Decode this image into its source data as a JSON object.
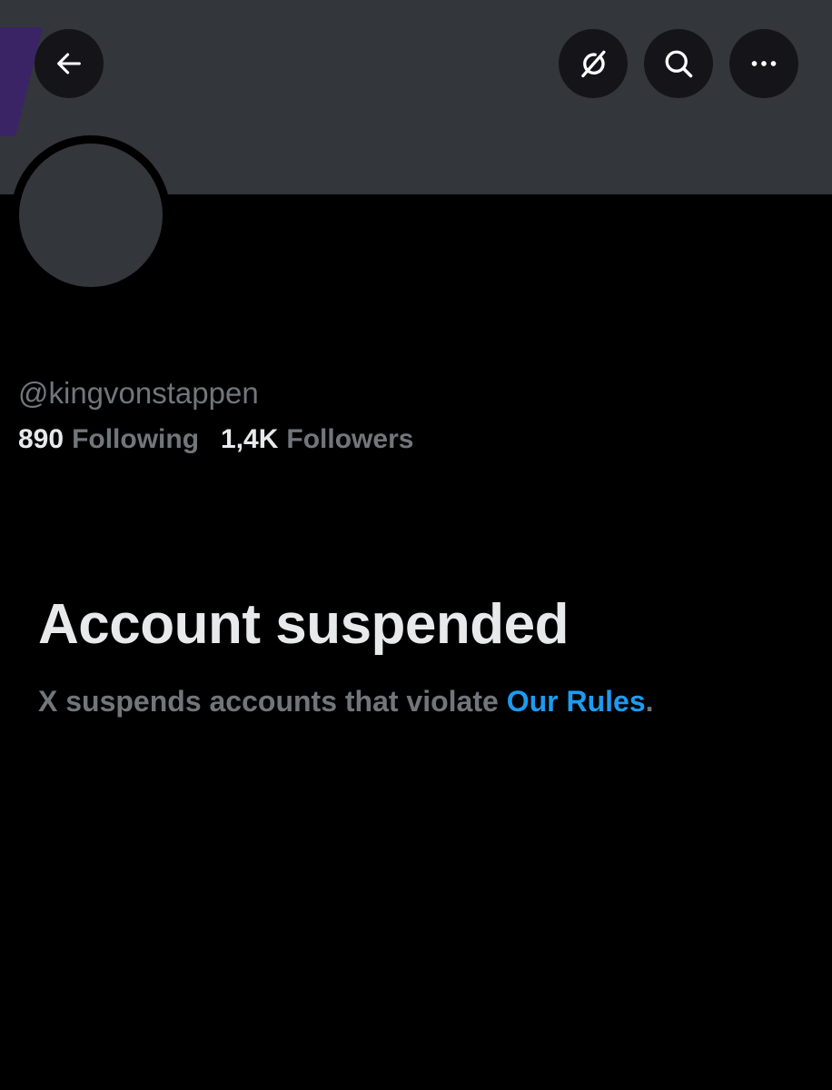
{
  "header": {
    "back_icon": "arrow-left-icon",
    "grok_icon": "grok-icon",
    "search_icon": "search-icon",
    "more_icon": "more-horizontal-icon"
  },
  "profile": {
    "handle": "@kingvonstappen",
    "following_count": "890",
    "following_label": "Following",
    "followers_count": "1,4K",
    "followers_label": "Followers"
  },
  "suspension": {
    "title": "Account suspended",
    "message_prefix": "X suspends accounts that violate ",
    "rules_link": "Our Rules",
    "message_suffix": "."
  },
  "colors": {
    "background": "#000000",
    "banner": "#33363b",
    "text_primary": "#e7e9ea",
    "text_secondary": "#71767b",
    "link": "#1d9bf0"
  }
}
